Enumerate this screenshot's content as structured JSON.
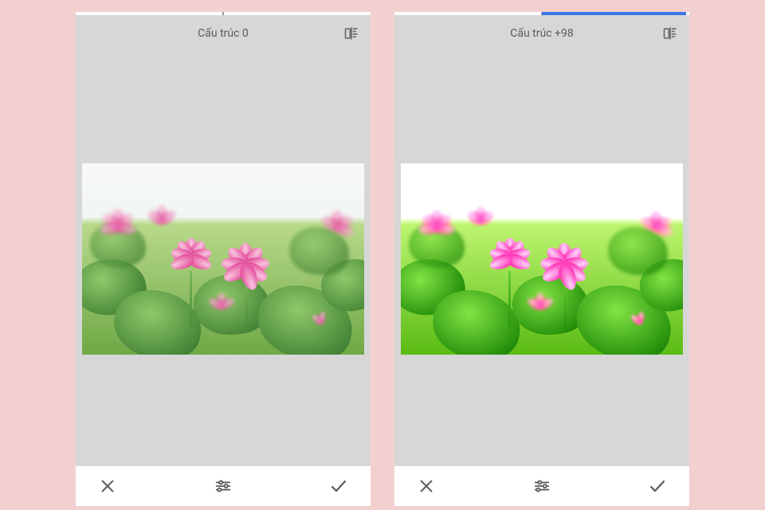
{
  "panels": [
    {
      "slider": {
        "value": 0,
        "fill_percent": 0
      },
      "header_label": "Cấu trúc 0",
      "enhanced": false
    },
    {
      "slider": {
        "value": 98,
        "fill_percent": 49
      },
      "header_label": "Cấu trúc +98",
      "enhanced": true
    }
  ],
  "icons": {
    "compare": "compare-icon",
    "cancel": "close-icon",
    "adjust": "sliders-icon",
    "confirm": "check-icon"
  },
  "colors": {
    "accent": "#3b78e7",
    "page_bg": "#f3d0d0",
    "canvas_bg": "#d7d7d7"
  }
}
